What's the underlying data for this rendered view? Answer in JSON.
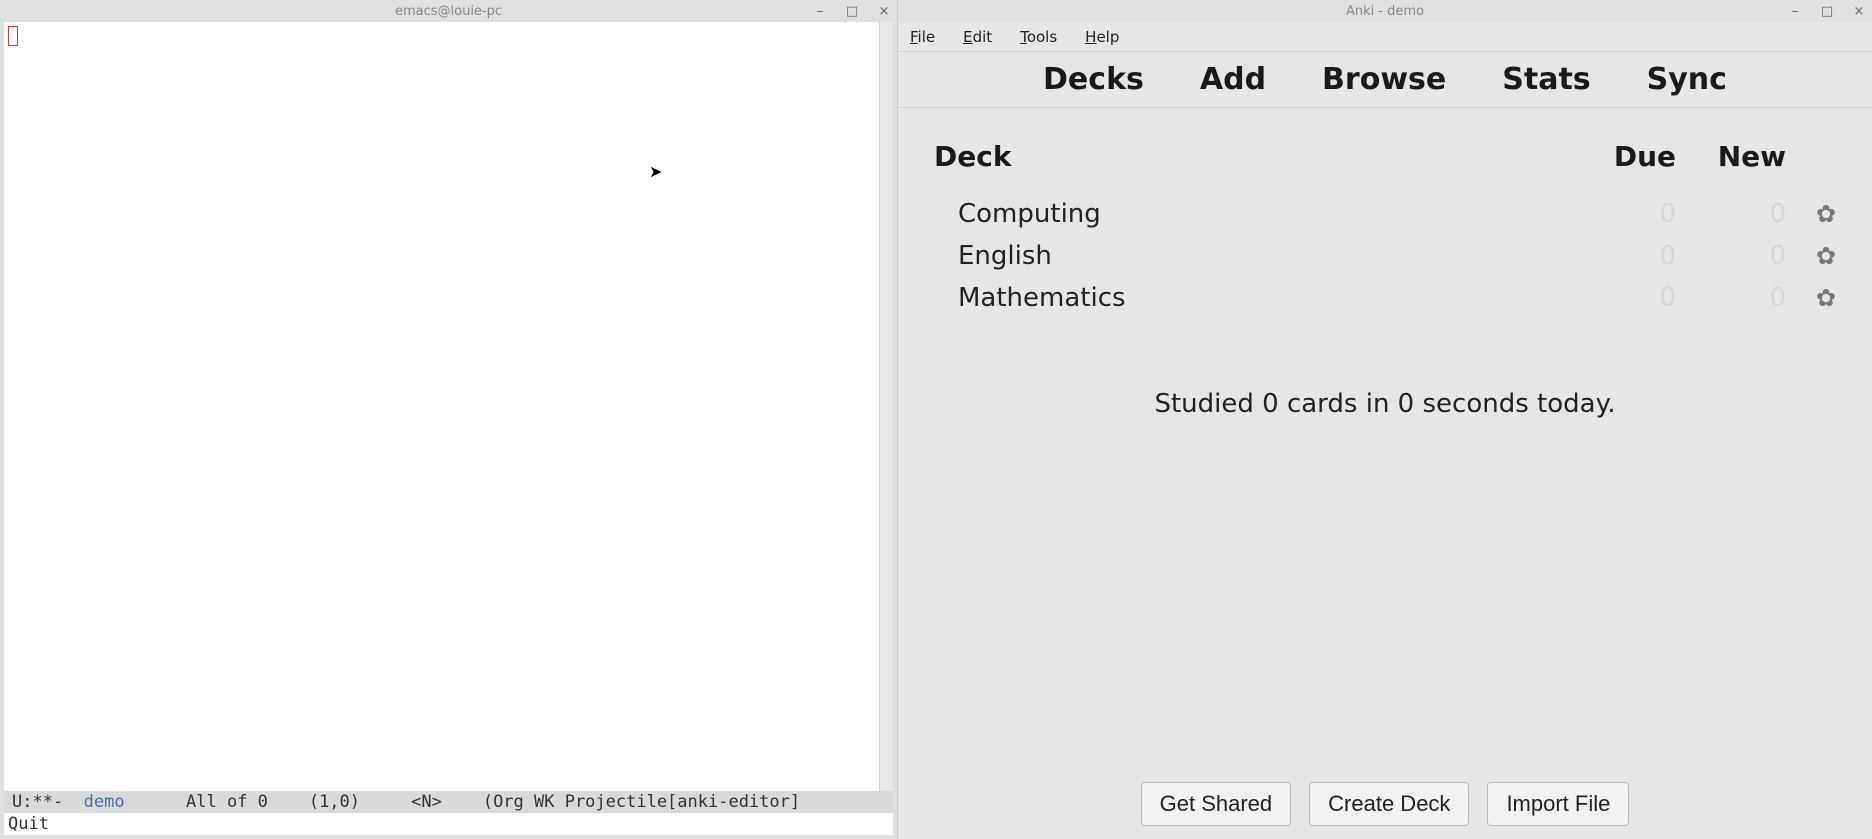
{
  "emacs": {
    "title": "emacs@louie-pc",
    "modeline": {
      "prefix": "U:**-  ",
      "buffer": "demo",
      "middle": "      All of 0    (1,0)     <N>    (Org WK Projectile[anki-editor]"
    },
    "minibuffer": "Quit"
  },
  "anki": {
    "title": "Anki - demo",
    "menu": {
      "file": "File",
      "edit": "Edit",
      "tools": "Tools",
      "help": "Help"
    },
    "toolbar": {
      "decks": "Decks",
      "add": "Add",
      "browse": "Browse",
      "stats": "Stats",
      "sync": "Sync"
    },
    "headers": {
      "deck": "Deck",
      "due": "Due",
      "new": "New"
    },
    "decks": [
      {
        "name": "Computing",
        "due": "0",
        "new": "0"
      },
      {
        "name": "English",
        "due": "0",
        "new": "0"
      },
      {
        "name": "Mathematics",
        "due": "0",
        "new": "0"
      }
    ],
    "status": "Studied 0 cards in 0 seconds today.",
    "footer": {
      "get_shared": "Get Shared",
      "create_deck": "Create Deck",
      "import_file": "Import File"
    }
  }
}
